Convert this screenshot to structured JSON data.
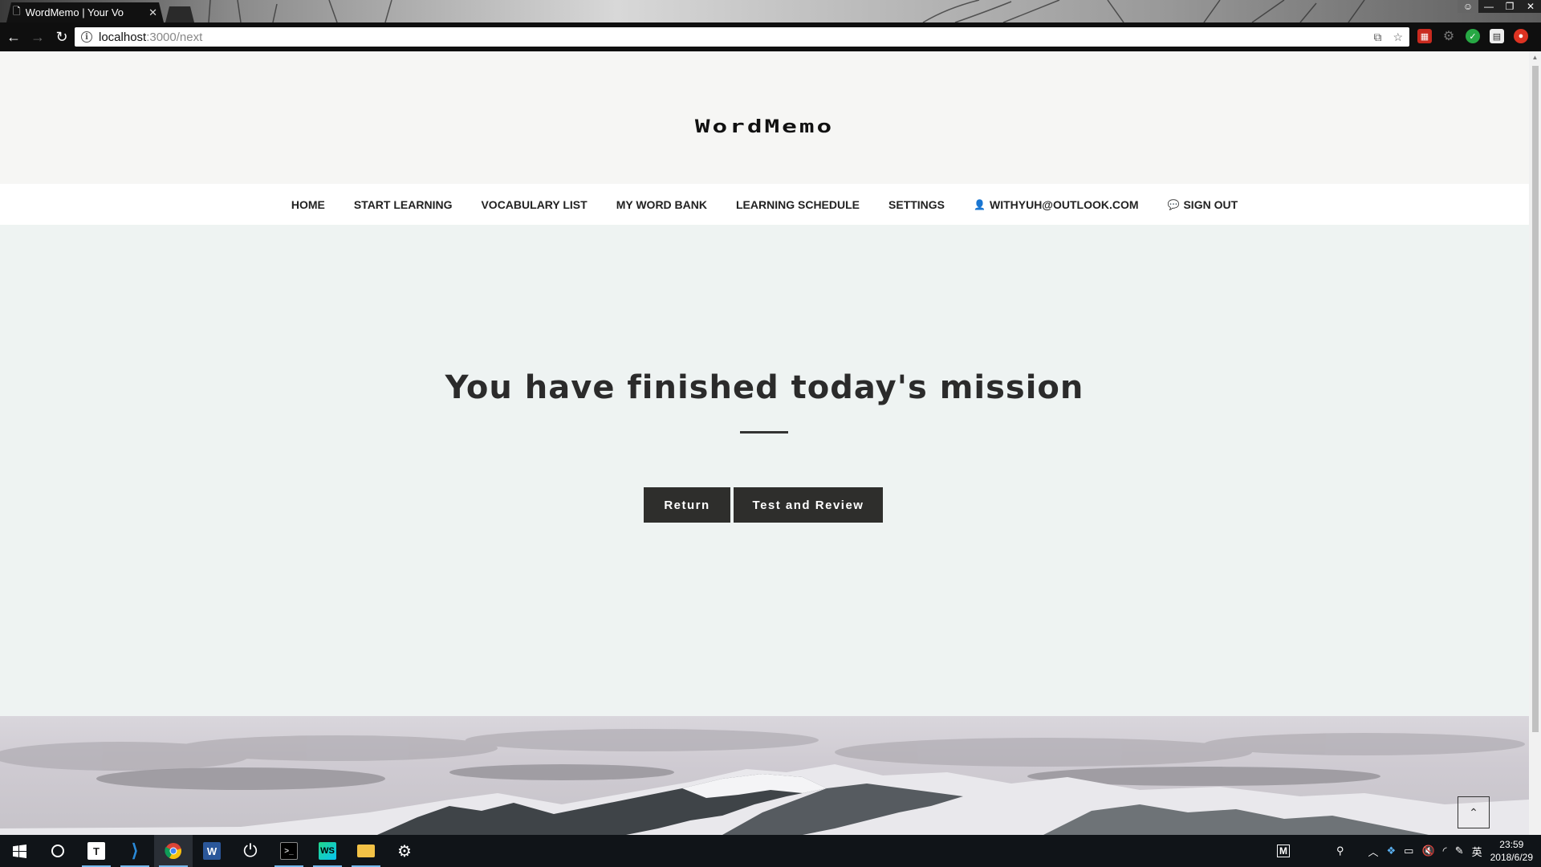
{
  "browser": {
    "tab_title": "WordMemo | Your Vo",
    "tab_close": "✕",
    "url_host": "localhost",
    "url_path": ":3000/next",
    "window_controls": {
      "minimize": "—",
      "maximize": "❐",
      "close": "✕"
    }
  },
  "site": {
    "logo": "WordMemo",
    "nav": {
      "home": "HOME",
      "start_learning": "START LEARNING",
      "vocabulary_list": "VOCABULARY LIST",
      "my_word_bank": "MY WORD BANK",
      "learning_schedule": "LEARNING SCHEDULE",
      "settings": "SETTINGS",
      "user_email": "WITHYUH@OUTLOOK.COM",
      "sign_out": "SIGN OUT"
    },
    "mission": {
      "title": "You have finished today's mission",
      "return_label": "Return",
      "review_label": "Test and Review"
    },
    "to_top_icon": "⌃"
  },
  "taskbar": {
    "clock_time": "23:59",
    "clock_date": "2018/6/29",
    "ime": "英",
    "tray_m": "M"
  },
  "colors": {
    "accent_dark": "#2e2e2c",
    "page_bg": "#eef3f2",
    "header_bg": "#f6f6f4",
    "taskbar_bg": "#101418"
  }
}
